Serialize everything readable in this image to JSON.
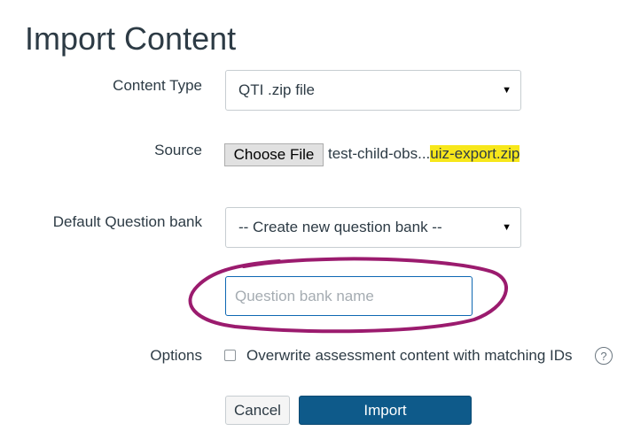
{
  "page": {
    "title": "Import Content"
  },
  "form": {
    "content_type": {
      "label": "Content Type",
      "selected": "QTI .zip file"
    },
    "source": {
      "label": "Source",
      "button_label": "Choose File",
      "file_name_prefix": "test-child-obs...",
      "file_name_highlighted": "uiz-export.zip"
    },
    "question_bank": {
      "label": "Default Question bank",
      "selected": "-- Create new question bank --",
      "name_placeholder": "Question bank name"
    },
    "options": {
      "label": "Options",
      "overwrite_label": "Overwrite assessment content with matching IDs",
      "help_icon": "help-icon",
      "help_glyph": "?"
    },
    "actions": {
      "cancel_label": "Cancel",
      "import_label": "Import"
    }
  },
  "colors": {
    "primary": "#0e5a8a",
    "annotation": "#9b1b6e",
    "highlight": "#f7e71b",
    "focus_border": "#0e68b3"
  }
}
